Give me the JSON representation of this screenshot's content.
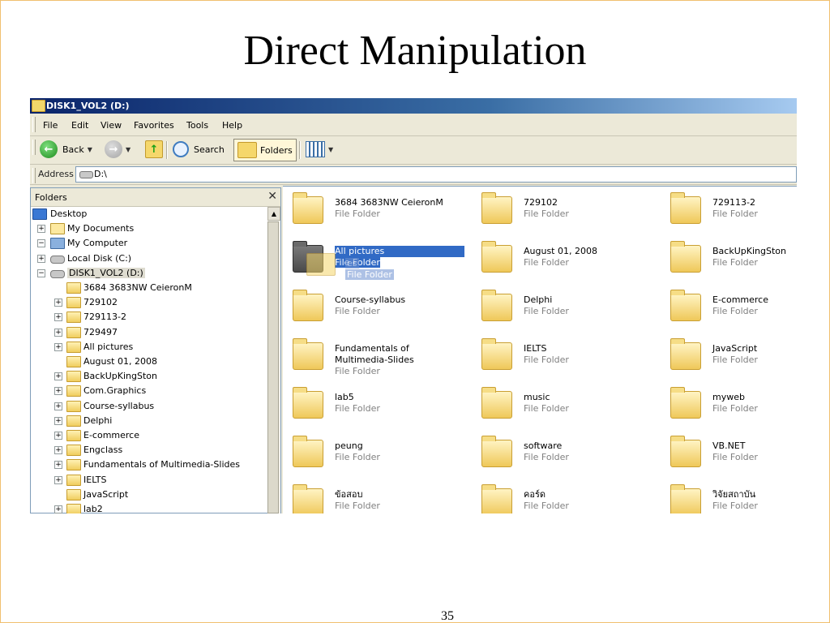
{
  "slide": {
    "title": "Direct Manipulation",
    "page_number": "35"
  },
  "window": {
    "title": "DISK1_VOL2 (D:)"
  },
  "menu": [
    "File",
    "Edit",
    "View",
    "Favorites",
    "Tools",
    "Help"
  ],
  "toolbar": {
    "back": "Back",
    "search": "Search",
    "folders": "Folders"
  },
  "address": {
    "label": "Address",
    "value": "D:\\"
  },
  "folders_pane": {
    "title": "Folders",
    "close": "✕",
    "tree": [
      {
        "label": "Desktop",
        "icon": "desktop-icon",
        "indent": 0,
        "expander": ""
      },
      {
        "label": "My Documents",
        "icon": "my-documents-icon",
        "indent": 1,
        "expander": "+"
      },
      {
        "label": "My Computer",
        "icon": "my-computer-icon",
        "indent": 1,
        "expander": "−"
      },
      {
        "label": "Local Disk (C:)",
        "icon": "drive-icon",
        "indent": 2,
        "expander": "+"
      },
      {
        "label": "DISK1_VOL2 (D:)",
        "icon": "drive-icon",
        "indent": 2,
        "expander": "−",
        "selected": true
      },
      {
        "label": "3684 3683NW CeieronM",
        "icon": "folder-icon",
        "indent": 3,
        "expander": ""
      },
      {
        "label": "729102",
        "icon": "folder-icon",
        "indent": 3,
        "expander": "+"
      },
      {
        "label": "729113-2",
        "icon": "folder-icon",
        "indent": 3,
        "expander": "+"
      },
      {
        "label": "729497",
        "icon": "folder-icon",
        "indent": 3,
        "expander": "+"
      },
      {
        "label": "All pictures",
        "icon": "folder-icon",
        "indent": 3,
        "expander": "+"
      },
      {
        "label": "August 01, 2008",
        "icon": "folder-icon",
        "indent": 3,
        "expander": ""
      },
      {
        "label": "BackUpKingSton",
        "icon": "folder-icon",
        "indent": 3,
        "expander": "+"
      },
      {
        "label": "Com.Graphics",
        "icon": "folder-icon",
        "indent": 3,
        "expander": "+"
      },
      {
        "label": "Course-syllabus",
        "icon": "folder-icon",
        "indent": 3,
        "expander": "+"
      },
      {
        "label": "Delphi",
        "icon": "folder-icon",
        "indent": 3,
        "expander": "+"
      },
      {
        "label": "E-commerce",
        "icon": "folder-icon",
        "indent": 3,
        "expander": "+"
      },
      {
        "label": "Engclass",
        "icon": "folder-icon",
        "indent": 3,
        "expander": "+"
      },
      {
        "label": "Fundamentals of Multimedia-Slides",
        "icon": "folder-icon",
        "indent": 3,
        "expander": "+"
      },
      {
        "label": "IELTS",
        "icon": "folder-icon",
        "indent": 3,
        "expander": "+"
      },
      {
        "label": "JavaScript",
        "icon": "folder-icon",
        "indent": 3,
        "expander": ""
      },
      {
        "label": "lab2",
        "icon": "folder-icon",
        "indent": 3,
        "expander": "+"
      }
    ]
  },
  "files": [
    {
      "name": "3684 3683NW CeieronM",
      "type": "File Folder"
    },
    {
      "name": "729102",
      "type": "File Folder"
    },
    {
      "name": "729113-2",
      "type": "File Folder"
    },
    {
      "name": "All pictures",
      "type": "File Folder",
      "selected": true
    },
    {
      "name": "August 01, 2008",
      "type": "File Folder"
    },
    {
      "name": "BackUpKingSton",
      "type": "File Folder"
    },
    {
      "name": "Course-syllabus",
      "type": "File Folder"
    },
    {
      "name": "Delphi",
      "type": "File Folder"
    },
    {
      "name": "E-commerce",
      "type": "File Folder"
    },
    {
      "name": "Fundamentals of Multimedia-Slides",
      "type": "File Folder"
    },
    {
      "name": "IELTS",
      "type": "File Folder"
    },
    {
      "name": "JavaScript",
      "type": "File Folder"
    },
    {
      "name": "lab5",
      "type": "File Folder"
    },
    {
      "name": "music",
      "type": "File Folder"
    },
    {
      "name": "myweb",
      "type": "File Folder"
    },
    {
      "name": "peung",
      "type": "File Folder"
    },
    {
      "name": "software",
      "type": "File Folder"
    },
    {
      "name": "VB.NET",
      "type": "File Folder"
    },
    {
      "name": "ข้อสอบ",
      "type": "File Folder"
    },
    {
      "name": "คอร์ด",
      "type": "File Folder"
    },
    {
      "name": "วิจัยสถาบัน",
      "type": "File Folder"
    }
  ],
  "drag_ghost": {
    "name": "es",
    "type": "File Folder"
  },
  "colors": {
    "selection": "#316ac5",
    "titlebar": "#0a246a",
    "slide_border": "#f0c070"
  }
}
